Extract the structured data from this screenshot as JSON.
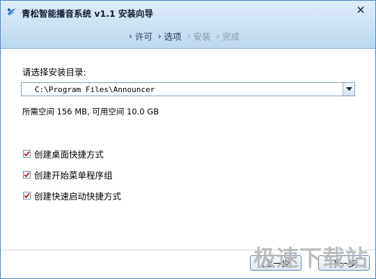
{
  "window": {
    "title": "青松智能播音系统 v1.1 安装向导",
    "icon": "app-icon",
    "close_icon": "close-icon"
  },
  "steps": [
    {
      "label": "许可",
      "state": "done"
    },
    {
      "label": "选项",
      "state": "current"
    },
    {
      "label": "安装",
      "state": "pending"
    },
    {
      "label": "完成",
      "state": "pending"
    }
  ],
  "install_dir": {
    "label": "请选择安装目录:",
    "path": "C:\\Program Files\\Announcer"
  },
  "space": {
    "required": "所需空间 156 MB,",
    "available": "可用空间 10.0 GB"
  },
  "options": [
    {
      "label": "创建桌面快捷方式",
      "checked": true
    },
    {
      "label": "创建开始菜单程序组",
      "checked": true
    },
    {
      "label": "创建快速启动快捷方式",
      "checked": true
    }
  ],
  "buttons": {
    "back": "(上一步",
    "next": "下一步"
  },
  "watermark": "极速下载站",
  "colors": {
    "header_top": "#dcecf9",
    "header_bottom": "#bcd8f1",
    "check_mark": "#c4161c",
    "pending_step": "#8a96a3"
  }
}
